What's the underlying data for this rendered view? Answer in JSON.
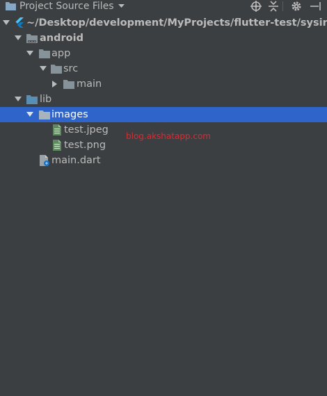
{
  "header": {
    "title": "Project Source Files",
    "icons": [
      "folder-icon",
      "dropdown-caret-icon",
      "locate-icon",
      "collapse-all-icon",
      "gear-icon",
      "hide-panel-icon"
    ]
  },
  "tree": {
    "root_label": "~/Desktop/development/MyProjects/flutter-test/sysinfo",
    "android_label": "android",
    "app_label": "app",
    "src_label": "src",
    "main_label": "main",
    "lib_label": "lib",
    "images_label": "images",
    "test_jpeg_label": "test.jpeg",
    "test_png_label": "test.png",
    "main_dart_label": "main.dart"
  },
  "watermark": "blog.akshatapp.com",
  "colors": {
    "background": "#3c3f41",
    "selection": "#2f65ca",
    "text": "#bbbbbb",
    "folder": "#87939a",
    "watermark": "#e0282e"
  }
}
